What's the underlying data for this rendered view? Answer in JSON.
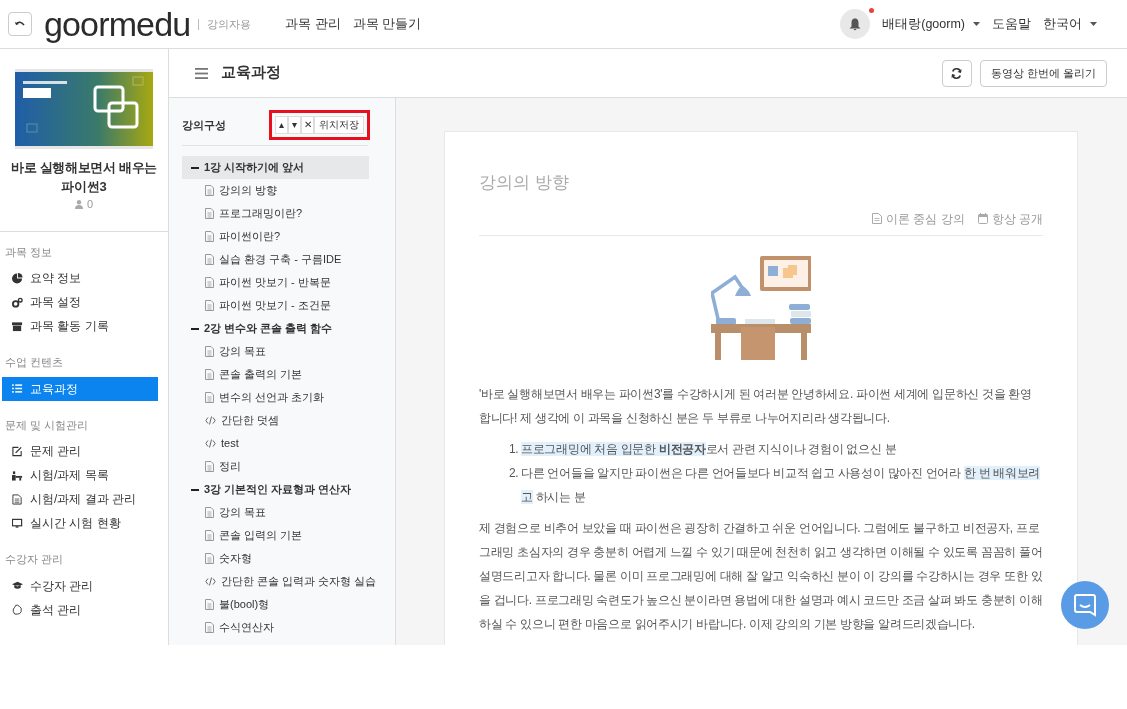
{
  "header": {
    "logo": "goormedu",
    "role": "강의자용",
    "nav": [
      "과목 관리",
      "과목 만들기"
    ],
    "notification_dot": true,
    "user": "배태랑(goorm)",
    "help": "도움말",
    "language": "한국어"
  },
  "course": {
    "title": "바로 실행해보면서 배우는 파이썬3",
    "students": "0"
  },
  "sidebar": {
    "sections": [
      {
        "title": "과목 정보",
        "items": [
          {
            "label": "요약 정보",
            "selected": false
          },
          {
            "label": "과목 설정",
            "selected": false
          },
          {
            "label": "과목 활동 기록",
            "selected": false
          }
        ]
      },
      {
        "title": "수업 컨텐츠",
        "items": [
          {
            "label": "교육과정",
            "selected": true
          }
        ]
      },
      {
        "title": "문제 및 시험관리",
        "items": [
          {
            "label": "문제 관리",
            "selected": false
          },
          {
            "label": "시험/과제 목록",
            "selected": false
          },
          {
            "label": "시험/과제 결과 관리",
            "selected": false
          },
          {
            "label": "실시간 시험 현황",
            "selected": false
          }
        ]
      },
      {
        "title": "수강자 관리",
        "items": [
          {
            "label": "수강자 관리",
            "selected": false
          },
          {
            "label": "출석 관리",
            "selected": false
          }
        ]
      }
    ]
  },
  "page_title": "교육과정",
  "page_actions": {
    "upload_button": "동영상 한번에 올리기"
  },
  "curriculum": {
    "title": "강의구성",
    "toolbar": {
      "outlined": true,
      "buttons": [
        "▴",
        "▾",
        "✕",
        "위치저장"
      ]
    },
    "chapters": [
      {
        "label": "1강 시작하기에 앞서",
        "selected": true,
        "expanded": true,
        "children": [
          {
            "label": "강의의 방향",
            "kind": "doc"
          },
          {
            "label": "프로그래밍이란?",
            "kind": "doc"
          },
          {
            "label": "파이썬이란?",
            "kind": "doc"
          },
          {
            "label": "실습 환경 구축 - 구름IDE",
            "kind": "doc"
          },
          {
            "label": "파이썬 맛보기 - 반복문",
            "kind": "doc"
          },
          {
            "label": "파이썬 맛보기 - 조건문",
            "kind": "doc"
          }
        ]
      },
      {
        "label": "2강 변수와 콘솔 출력 함수",
        "selected": false,
        "expanded": true,
        "children": [
          {
            "label": "강의 목표",
            "kind": "doc"
          },
          {
            "label": "콘솔 출력의 기본",
            "kind": "doc"
          },
          {
            "label": "변수의 선언과 초기화",
            "kind": "doc"
          },
          {
            "label": "간단한 덧셈",
            "kind": "code"
          },
          {
            "label": "test",
            "kind": "code"
          },
          {
            "label": "정리",
            "kind": "doc"
          }
        ]
      },
      {
        "label": "3강 기본적인 자료형과 연산자",
        "selected": false,
        "expanded": true,
        "children": [
          {
            "label": "강의 목표",
            "kind": "doc"
          },
          {
            "label": "콘솔 입력의 기본",
            "kind": "doc"
          },
          {
            "label": "숫자형",
            "kind": "doc"
          },
          {
            "label": "간단한 콘솔 입력과 숫자형 실습",
            "kind": "code"
          },
          {
            "label": "불(bool)형",
            "kind": "doc"
          },
          {
            "label": "수식연산자",
            "kind": "doc"
          }
        ]
      }
    ]
  },
  "lesson": {
    "title": "강의의 방향",
    "meta": [
      {
        "label": "이론 중심 강의",
        "kind": "type"
      },
      {
        "label": "항상 공개",
        "kind": "schedule"
      }
    ],
    "body": [
      {
        "kind": "paragraph",
        "text": "'바로 실행해보면서 배우는 파이썬3'를 수강하시게 된 여러분 안녕하세요. 파이썬 세계에 입문하신 것을 환영합니다! 제 생각에 이 과목을 신청하신 분은 두 부류로 나누어지리라 생각됩니다."
      },
      {
        "kind": "list",
        "items": [
          {
            "number": "1.",
            "segments": [
              {
                "text": "프로그래밍에 처음 입문한 **비전공자**",
                "highlight": true
              },
              {
                "text": "로서 관련 지식이나 경험이 없으신 분",
                "highlight": false
              }
            ]
          },
          {
            "number": "2.",
            "segments": [
              {
                "text": "다른 언어들을 알지만 파이썬은 다른 언어들보다 비교적 쉽고 사용성이 많아진 언어라 ",
                "highlight": false
              },
              {
                "text": "한 번 배워보려고",
                "highlight": true
              },
              {
                "text": " 하시는 분",
                "highlight": false
              }
            ]
          }
        ]
      },
      {
        "kind": "paragraph",
        "text": "제 경험으로 비추어 보았을 때 파이썬은 굉장히 간결하고 쉬운 언어입니다. 그럼에도 불구하고 비전공자, 프로그래밍 초심자의 경우 충분히 어렵게 느낄 수 있기 때문에 천천히 읽고 생각하면 이해될 수 있도록 꼼꼼히 풀어 설명드리고자 합니다. 물론 이미 프로그래밍에 대해 잘 알고 익숙하신 분이 이 강의를 수강하시는 경우 또한 있을 겁니다. 프로그래밍 숙련도가 높으신 분이라면 용법에 대한 설명과 예시 코드만 조금 살펴 봐도 충분히 이해하실 수 있으니 편한 마음으로 읽어주시기 바랍니다. 이제 강의의 기본 방향을 알려드리겠습니다."
      }
    ]
  }
}
